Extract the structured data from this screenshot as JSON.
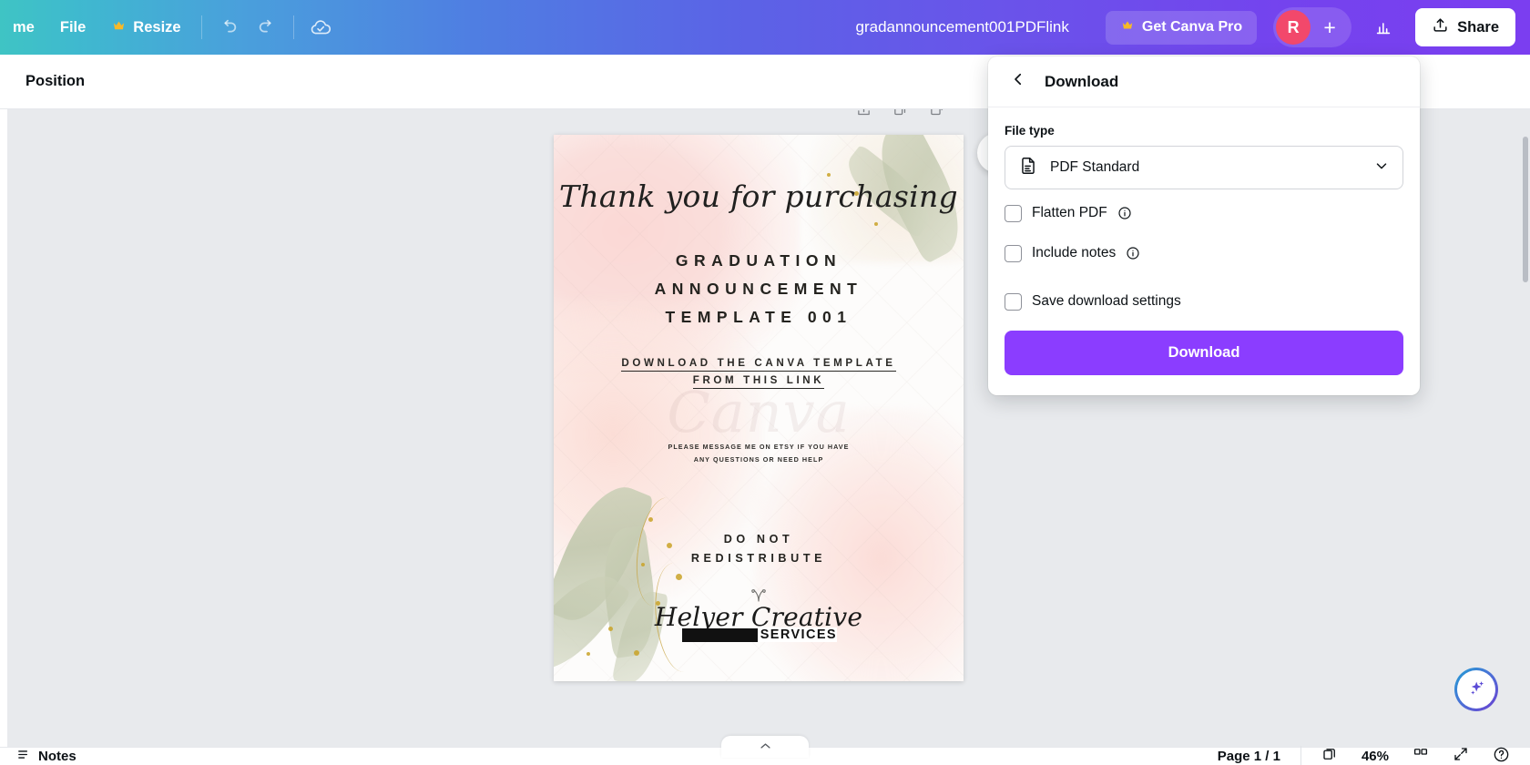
{
  "topbar": {
    "home_label": "me",
    "file_label": "File",
    "resize_label": "Resize",
    "crown_glyph": "♛",
    "undo_name": "undo-icon",
    "redo_name": "redo-icon",
    "cloud_saved_name": "cloud-saved-icon",
    "doc_title": "gradannouncement001PDFlink",
    "pro_label": "Get Canva Pro",
    "avatar_initial": "R",
    "plus_label": "+",
    "insights_name": "insights-icon",
    "share_label": "Share",
    "accent_bg_start": "#3fc4c4",
    "accent_bg_end": "#7b3ef0",
    "avatar_color": "#f2486b"
  },
  "positionbar": {
    "position_label": "Position"
  },
  "workspace": {
    "background": "#e8eaed",
    "page_tools": [
      "export-page-icon",
      "duplicate-page-icon",
      "delete-page-icon"
    ],
    "comment_button_name": "add-comment-icon"
  },
  "design": {
    "script_heading": "Thank you for purchasing",
    "title_lines": [
      "GRADUATION",
      "ANNOUNCEMENT",
      "TEMPLATE 001"
    ],
    "link_lines": [
      "DOWNLOAD THE CANVA TEMPLATE",
      "FROM THIS LINK"
    ],
    "note_lines": [
      "PLEASE MESSAGE ME ON ETSY IF YOU HAVE",
      "ANY QUESTIONS OR NEED HELP"
    ],
    "do_not_lines": [
      "DO NOT",
      "REDISTRIBUTE"
    ],
    "logo_script": "Helyer Creative",
    "logo_services": "SERVICES",
    "watermark": "Canva"
  },
  "download_panel": {
    "back_icon": "chevron-left-icon",
    "title": "Download",
    "file_type_label": "File type",
    "file_type_value": "PDF Standard",
    "file_type_icon": "pdf-document-icon",
    "chevron_icon": "chevron-down-icon",
    "options": [
      {
        "label": "Flatten PDF",
        "checked": false,
        "has_info": true
      },
      {
        "label": "Include notes",
        "checked": false,
        "has_info": true
      },
      {
        "label": "Save download settings",
        "checked": false,
        "has_info": false
      }
    ],
    "download_button": "Download",
    "button_color": "#8b3dff"
  },
  "bottombar": {
    "notes_label": "Notes",
    "notes_icon": "notes-icon",
    "page_label": "Page 1 / 1",
    "duplicate_icon": "duplicate-icon",
    "delete_icon": "trash-icon",
    "zoom_level": "46%",
    "grid_icon": "grid-view-icon",
    "expand_icon": "fullscreen-icon",
    "help_icon": "help-icon"
  },
  "magic_fab": {
    "name": "magic-studio-icon"
  }
}
